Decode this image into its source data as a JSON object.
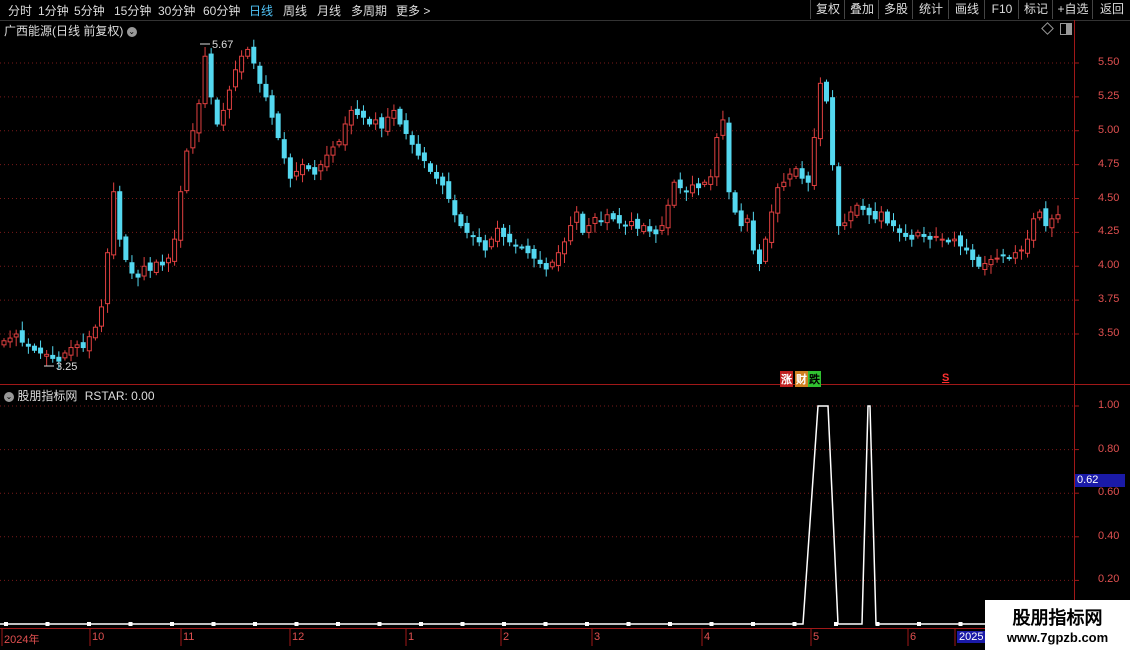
{
  "toolbar": {
    "periods": [
      "分时",
      "1分钟",
      "5分钟",
      "15分钟",
      "30分钟",
      "60分钟",
      "日线",
      "周线",
      "月线",
      "多周期"
    ],
    "more": "更多 >",
    "active_period": "日线",
    "right_buttons": [
      "复权",
      "叠加",
      "多股",
      "统计",
      "画线",
      "F10",
      "标记",
      "+自选",
      "返回"
    ]
  },
  "main_panel": {
    "title": "广西能源(日线 前复权)",
    "high_label": "5.67",
    "low_label": "3.25",
    "events": {
      "zhang": "涨",
      "cai": "财",
      "die": "跌",
      "s": "S"
    }
  },
  "sub_panel": {
    "title": "股朋指标网",
    "indicator": "RSTAR: 0.00",
    "current_value": "0.62"
  },
  "watermark": {
    "line1": "股朋指标网",
    "line2": "www.7gpzb.com"
  },
  "colors": {
    "up": "#e04040",
    "down": "#54d8f0",
    "grid": "#7a1a1a",
    "axis": "#a01818",
    "line": "#ffffff"
  },
  "chart_data": [
    {
      "type": "candlestick",
      "title": "广西能源(日线 前复权)",
      "y_ticks": [
        3.5,
        3.75,
        4.0,
        4.25,
        4.5,
        4.75,
        5.0,
        5.25,
        5.5
      ],
      "ylim": [
        3.25,
        5.75
      ],
      "x_ticks": [
        "2024年",
        "10",
        "11",
        "12",
        "1",
        "2",
        "3",
        "4",
        "5",
        "6",
        "2025"
      ],
      "max": 5.67,
      "min": 3.25,
      "closes": [
        3.45,
        3.47,
        3.5,
        3.44,
        3.41,
        3.38,
        3.36,
        3.35,
        3.32,
        3.3,
        3.36,
        3.4,
        3.42,
        3.4,
        3.48,
        3.55,
        3.7,
        4.1,
        4.55,
        4.2,
        4.05,
        3.95,
        3.92,
        4.0,
        3.97,
        4.03,
        4.01,
        4.06,
        4.2,
        4.55,
        4.85,
        5.0,
        5.2,
        5.55,
        5.25,
        5.05,
        5.15,
        5.3,
        5.45,
        5.55,
        5.6,
        5.5,
        5.35,
        5.25,
        5.1,
        4.95,
        4.8,
        4.65,
        4.7,
        4.75,
        4.72,
        4.68,
        4.75,
        4.82,
        4.88,
        4.92,
        5.05,
        5.15,
        5.12,
        5.1,
        5.05,
        5.08,
        5.02,
        5.1,
        5.15,
        5.05,
        4.98,
        4.9,
        4.82,
        4.78,
        4.7,
        4.65,
        4.6,
        4.5,
        4.38,
        4.3,
        4.25,
        4.22,
        4.18,
        4.12,
        4.2,
        4.28,
        4.22,
        4.18,
        4.15,
        4.14,
        4.1,
        4.06,
        4.02,
        3.98,
        4.03,
        4.1,
        4.18,
        4.3,
        4.4,
        4.25,
        4.3,
        4.36,
        4.33,
        4.38,
        4.35,
        4.32,
        4.3,
        4.33,
        4.28,
        4.3,
        4.26,
        4.24,
        4.3,
        4.45,
        4.62,
        4.58,
        4.55,
        4.6,
        4.58,
        4.62,
        4.66,
        4.95,
        5.08,
        4.55,
        4.4,
        4.3,
        4.35,
        4.12,
        4.02,
        4.2,
        4.4,
        4.58,
        4.62,
        4.68,
        4.72,
        4.65,
        4.62,
        4.95,
        5.35,
        5.22,
        4.75,
        4.3,
        4.32,
        4.4,
        4.45,
        4.42,
        4.38,
        4.35,
        4.4,
        4.32,
        4.3,
        4.25,
        4.22,
        4.2,
        4.25,
        4.22,
        4.2,
        4.22,
        4.2,
        4.18,
        4.2,
        4.15,
        4.12,
        4.05,
        4.0,
        4.02,
        4.05,
        4.06,
        4.08,
        4.06,
        4.1,
        4.12,
        4.2,
        4.35,
        4.4,
        4.3,
        4.35,
        4.38
      ]
    },
    {
      "type": "line",
      "name": "RSTAR",
      "y_ticks": [
        0.2,
        0.4,
        0.6,
        0.8,
        1.0
      ],
      "ylim": [
        0,
        1.1
      ],
      "pulses": [
        {
          "rise_at": 803,
          "flat_from": 818,
          "flat_to": 828,
          "fall_at": 838,
          "value": 1.0
        },
        {
          "rise_at": 862,
          "flat_from": 868,
          "flat_to": 870,
          "fall_at": 876,
          "value": 1.0
        }
      ],
      "current_label": 0.62
    }
  ]
}
